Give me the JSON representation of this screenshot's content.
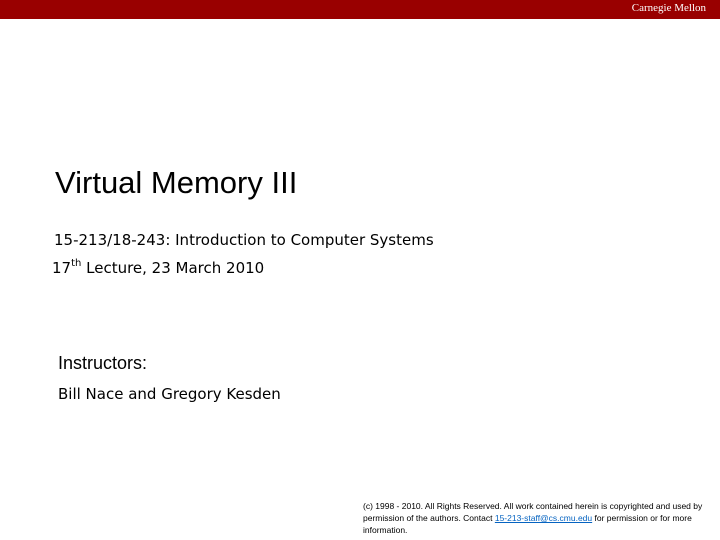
{
  "header": {
    "brand": "Carnegie Mellon"
  },
  "slide": {
    "title": "Virtual Memory III",
    "course": "15-213/18-243: Introduction to Computer Systems",
    "lecture_number": "17",
    "lecture_suffix": "th",
    "lecture_rest": " Lecture, 23 March 2010",
    "instructors_label": "Instructors:",
    "instructors": "Bill Nace and Gregory Kesden"
  },
  "footer": {
    "copyright_text": "(c) 1998 - 2010. All Rights Reserved. All work contained herein is copyrighted and used by permission of the authors. Contact",
    "contact_email": "15-213-staff@cs.cmu.edu",
    "copyright_tail": " for permission or for more information."
  },
  "colors": {
    "banner": "#990000",
    "link": "#0563c1"
  }
}
